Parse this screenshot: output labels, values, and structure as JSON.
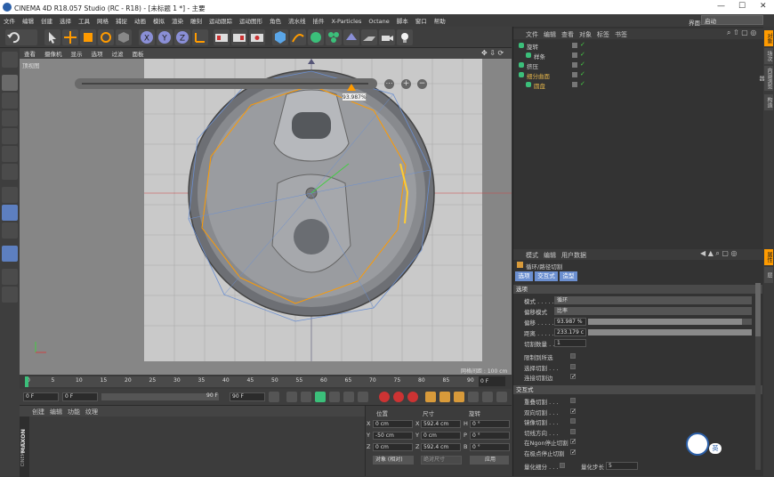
{
  "window": {
    "title": "CINEMA 4D R18.057 Studio (RC - R18) - [未标题 1 *] - 主要",
    "controls": [
      "—",
      "☐",
      "✕"
    ]
  },
  "menubar": {
    "items": [
      "文件",
      "编辑",
      "创建",
      "选择",
      "工具",
      "网格",
      "捕捉",
      "动画",
      "模拟",
      "渲染",
      "雕刻",
      "运动跟踪",
      "运动图形",
      "角色",
      "流水线",
      "插件",
      "X-Particles",
      "Octane",
      "脚本",
      "窗口",
      "帮助"
    ],
    "layout_label": "界面:",
    "layout_value": "启动"
  },
  "viewport": {
    "menu": [
      "查看",
      "摄像机",
      "显示",
      "选项",
      "过滤",
      "面板"
    ],
    "view_name": "顶视图",
    "slider_value": "93.987%",
    "grid_spacing": "网格间距 : 100 cm"
  },
  "timeline": {
    "ticks": [
      "0",
      "5",
      "10",
      "15",
      "20",
      "25",
      "30",
      "35",
      "40",
      "45",
      "50",
      "55",
      "60",
      "65",
      "70",
      "75",
      "80",
      "85",
      "90"
    ],
    "end_frame": "0 F",
    "current_frame": "0 F",
    "start_field": "0 F",
    "end_field": "90 F",
    "max_field": "90 F",
    "progress": 0
  },
  "material_manager": {
    "menu": [
      "创建",
      "编辑",
      "功能",
      "纹理"
    ],
    "logo": "MAXON",
    "logo2": "CINEMA 4D"
  },
  "coordinates": {
    "headers": [
      "位置",
      "尺寸",
      "旋转"
    ],
    "rows": [
      {
        "axis": "X",
        "pos": "0 cm",
        "size_axis": "X",
        "size": "592.4 cm",
        "rot_axis": "H",
        "rot": "0 °"
      },
      {
        "axis": "Y",
        "pos": "-50 cm",
        "size_axis": "Y",
        "size": "0 cm",
        "rot_axis": "P",
        "rot": "0 °"
      },
      {
        "axis": "Z",
        "pos": "0 cm",
        "size_axis": "Z",
        "size": "592.4 cm",
        "rot_axis": "B",
        "rot": "0 °"
      }
    ],
    "mode1": "对象 (相对)",
    "mode2": "绝对尺寸",
    "apply": "应用"
  },
  "object_manager": {
    "menu": [
      "文件",
      "编辑",
      "查看",
      "对象",
      "标签",
      "书签"
    ],
    "objects": [
      {
        "name": "旋转",
        "indent": 0,
        "color": "#cfcfcf"
      },
      {
        "name": "样条",
        "indent": 1,
        "color": "#cfcfcf"
      },
      {
        "name": "挤压",
        "indent": 0,
        "color": "#cfcfcf"
      },
      {
        "name": "细分曲面",
        "indent": 0,
        "color": "#e0b24a"
      },
      {
        "name": "圆盘",
        "indent": 1,
        "color": "#e0b24a"
      }
    ]
  },
  "attribute_manager": {
    "menu": [
      "模式",
      "编辑",
      "用户数据"
    ],
    "tool_title": "循环/路径切割",
    "tabs": [
      "选项",
      "交互式",
      "造型"
    ],
    "section1": "选项",
    "mode_label": "模式 . . . . . .",
    "mode_value": "循环",
    "offset_mode_label": "偏移模式",
    "offset_mode_value": "比率",
    "offset_label": "偏移 . . . . . .",
    "offset_value": "93.987 %",
    "offset_fraction": 0.93987,
    "distance_label": "距离 . . . . . .",
    "distance_value": "233.179 c",
    "distance_fraction": 1.0,
    "cut_count_label": "切割数量 . . .",
    "cut_count_value": "1",
    "checks1": [
      {
        "label": "限制到所选",
        "checked": false
      },
      {
        "label": "选择切割 . . .",
        "checked": false
      },
      {
        "label": "连接切割边",
        "checked": true
      }
    ],
    "section2": "交互式",
    "checks2": [
      {
        "label": "重叠切割 . . .",
        "checked": false
      },
      {
        "label": "双向切割 . . .",
        "checked": true
      },
      {
        "label": "镜像切割 . . .",
        "checked": false
      },
      {
        "label": "切线方向 . . .",
        "checked": false
      },
      {
        "label": "在Ngon停止切割",
        "checked": true
      },
      {
        "label": "在极点停止切割",
        "checked": true
      }
    ],
    "quantize_label": "量化细分 . . .",
    "quantize_step_label": "量化步长",
    "quantize_step_value": "5",
    "badge_text": "英"
  },
  "colors": {
    "accent": "#ff9b00",
    "selection_blue": "#6b8fd0"
  }
}
